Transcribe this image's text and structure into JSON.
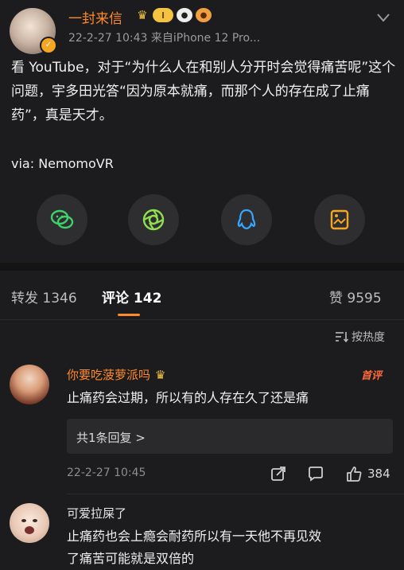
{
  "post": {
    "username": "一封来信",
    "level_badge": "I",
    "meta": "22-2-27 10:43  来自iPhone 12 Pro...",
    "text": "看 YouTube，对于“为什么人在和别人分开时会觉得痛苦呢”这个问题，宇多田光答“因为原本就痛，而那个人的存在成了止痛药”，真是天才。",
    "via": "via: NemomoVR",
    "share_icons": [
      "wechat-icon",
      "moments-icon",
      "qq-icon",
      "save-image-icon"
    ]
  },
  "tabs": {
    "repost": "转发 1346",
    "comments": "评论 142",
    "likes": "赞 9595"
  },
  "sort": {
    "label": "按热度"
  },
  "comments": [
    {
      "name": "你要吃菠萝派吗",
      "first_badge": "首评",
      "text": "止痛药会过期，所以有的人存在久了还是痛",
      "reply_summary": "共1条回复 >",
      "time": "22-2-27 10:45",
      "likes": "384"
    },
    {
      "name": "可爱拉屎了",
      "text_line1": "止痛药也会上瘾会耐药所以有一天他不再见效",
      "text_line2": "了痛苦可能就是双倍的"
    }
  ],
  "colors": {
    "accent": "#ff8a2a",
    "background": "#1c1c1e"
  }
}
